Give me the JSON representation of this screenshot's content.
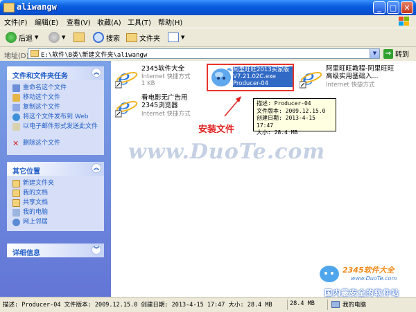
{
  "window": {
    "title": "aliwangw"
  },
  "menu": [
    "文件(F)",
    "编辑(E)",
    "查看(V)",
    "收藏(A)",
    "工具(T)",
    "帮助(H)"
  ],
  "toolbar": {
    "back": "后退",
    "search": "搜索",
    "folders": "文件夹"
  },
  "address": {
    "label": "地址(D)",
    "path": "E:\\软件\\B类\\新建文件夹\\aliwangw",
    "go": "转到"
  },
  "panels": {
    "file_tasks": {
      "title": "文件和文件夹任务",
      "items": [
        "重命名这个文件",
        "移动这个文件",
        "复制这个文件",
        "将这个文件发布到 Web",
        "以电子邮件形式发送此文件",
        "删除这个文件"
      ]
    },
    "other_places": {
      "title": "其它位置",
      "items": [
        "新建文件夹",
        "我的文档",
        "共享文档",
        "我的电脑",
        "网上邻居"
      ]
    },
    "details": {
      "title": "详细信息"
    }
  },
  "files": [
    {
      "name": "2345软件大全",
      "type": "Internet 快捷方式",
      "size": "1 KB"
    },
    {
      "name": "阿里旺旺2013买家版V7.21.02C.exe",
      "type": "Producer-04"
    },
    {
      "name": "阿里旺旺教程-阿里旺旺高级实用基础入...",
      "type": "Internet 快捷方式"
    },
    {
      "name": "看电影无广告用2345浏览器",
      "type": "Internet 快捷方式"
    }
  ],
  "tooltip": {
    "lines": [
      "描述: Producer-04",
      "文件版本: 2009.12.15.0",
      "创建日期: 2013-4-15 17:47",
      "大小: 28.4 MB"
    ]
  },
  "annotation": "安装文件",
  "watermark": "www.DuoTe.com",
  "status": {
    "info": "描述: Producer-04 文件版本: 2009.12.15.0 创建日期: 2013-4-15 17:47 大小: 28.4 MB",
    "size": "28.4 MB",
    "location": "我的电脑"
  },
  "logo": {
    "brand": "2345软件大全",
    "url": "www.DuoTe.com",
    "slogan": "国内最安全的软件站"
  },
  "colors": {
    "titlebar": "#0753D6",
    "selection": "#316AC5",
    "annotation": "#E02020",
    "panel_text": "#215DC6"
  }
}
